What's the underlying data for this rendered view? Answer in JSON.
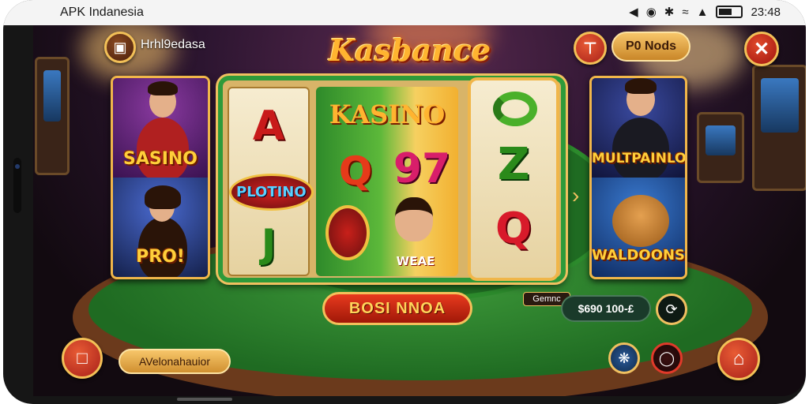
{
  "status_bar": {
    "app_name": "APK Indanesia",
    "time": "23:48",
    "icons": [
      "navigation-arrow-icon",
      "record-icon",
      "bluetooth-icon",
      "wifi-icon",
      "signal-icon",
      "battery-icon"
    ]
  },
  "header": {
    "username": "Hrhl9edasa",
    "game_logo": "Kasbance",
    "pill_button": "P0 Nods"
  },
  "left_card": {
    "top_title": "SASINO",
    "bottom_title": "PRO!"
  },
  "slot": {
    "left_reel": [
      "A",
      "PLOTINO",
      "J"
    ],
    "center_banner": "KASINO",
    "center_symbols": [
      "Q",
      "97"
    ],
    "center_label": "WEAE",
    "right_reel": [
      "Z",
      "Q"
    ],
    "right_caption": "Gemnc"
  },
  "right_card": {
    "top_title": "MULTPAINLO",
    "bottom_title": "WALDOONS"
  },
  "controls": {
    "main_button": "BOSI NNOA",
    "balance": "$690 100-£",
    "bottom_pill": "AVelonahauior"
  },
  "colors": {
    "gold": "#f0b64a",
    "red": "#c8241a",
    "felt_green": "#2c8a2c"
  }
}
